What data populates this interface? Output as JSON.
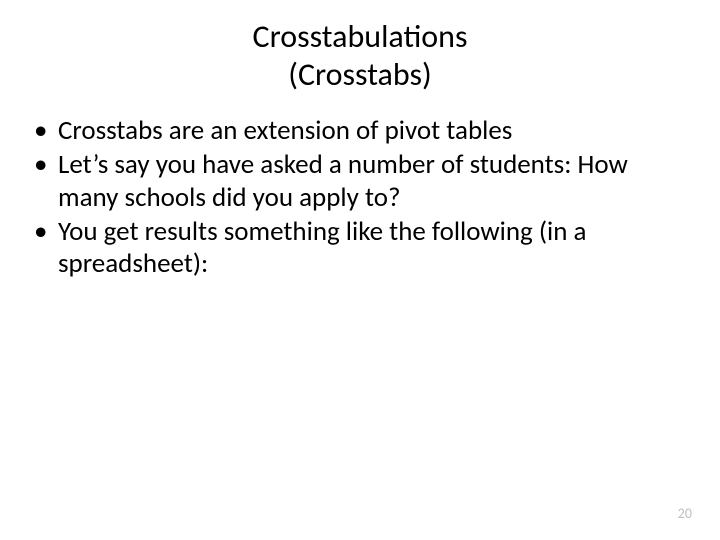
{
  "title": {
    "line1": "Crosstabulations",
    "line2": "(Crosstabs)"
  },
  "bullets": {
    "item1": "Crosstabs are an extension of pivot tables",
    "item2": "Let’s say you have asked a number of students: How many schools did you apply to?",
    "item3": "You get results something like the following (in a spreadsheet):"
  },
  "pageNumber": "20"
}
